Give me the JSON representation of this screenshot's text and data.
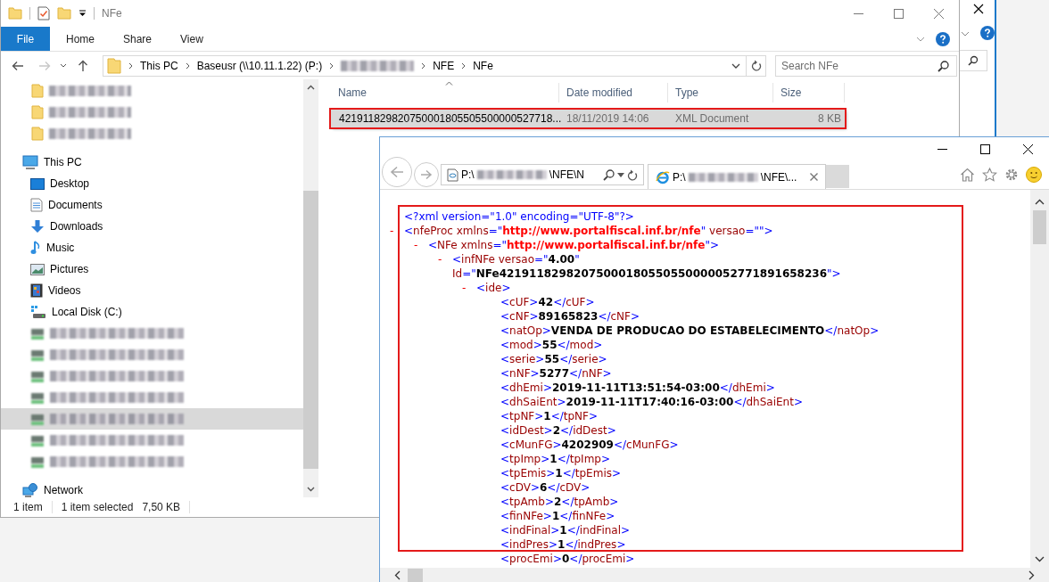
{
  "explorer": {
    "title": "NFe",
    "ribbon_tabs": [
      {
        "label": "File",
        "selected": true
      },
      {
        "label": "Home",
        "selected": false
      },
      {
        "label": "Share",
        "selected": false
      },
      {
        "label": "View",
        "selected": false
      }
    ],
    "breadcrumb": [
      {
        "kind": "text",
        "label": "This PC"
      },
      {
        "kind": "text",
        "label": "Baseusr (\\\\10.11.1.22) (P:)"
      },
      {
        "kind": "blurred"
      },
      {
        "kind": "text",
        "label": "NFE"
      },
      {
        "kind": "text",
        "label": "NFe"
      }
    ],
    "search": {
      "placeholder": "Search NFe"
    },
    "nav": [
      {
        "kind": "folder",
        "selected": false
      },
      {
        "kind": "folder",
        "selected": false
      },
      {
        "kind": "folder",
        "selected": false
      },
      {
        "kind": "pc",
        "label": "This PC",
        "selected": false,
        "children": [
          {
            "kind": "desktop",
            "label": "Desktop",
            "selected": false
          },
          {
            "kind": "documents",
            "label": "Documents",
            "selected": false
          },
          {
            "kind": "downloads",
            "label": "Downloads",
            "selected": false
          },
          {
            "kind": "music",
            "label": "Music",
            "selected": false
          },
          {
            "kind": "pictures",
            "label": "Pictures",
            "selected": false
          },
          {
            "kind": "videos",
            "label": "Videos",
            "selected": false
          },
          {
            "kind": "disk",
            "label": "Local Disk (C:)",
            "selected": false
          },
          {
            "kind": "drive",
            "selected": false
          },
          {
            "kind": "drive",
            "selected": false
          },
          {
            "kind": "drive",
            "selected": false
          },
          {
            "kind": "drive",
            "selected": false
          },
          {
            "kind": "drive",
            "selected": true
          },
          {
            "kind": "drive",
            "selected": false
          },
          {
            "kind": "drive",
            "selected": false
          }
        ]
      },
      {
        "kind": "network",
        "label": "Network",
        "selected": false
      }
    ],
    "columns": [
      "Name",
      "Date modified",
      "Type",
      "Size"
    ],
    "files": [
      {
        "name": "421911829820750001805505500000527718...",
        "date": "18/11/2019 14:06",
        "type": "XML Document",
        "size": "8 KB",
        "selected": true,
        "highlighted": true
      }
    ],
    "status": {
      "count": "1 item",
      "selection": "1 item selected",
      "size": "7,50 KB"
    }
  },
  "browser": {
    "address": {
      "prefix": "P:\\",
      "suffix": "\\NFE\\N"
    },
    "tab": {
      "prefix": "P:\\",
      "suffix": "\\NFE\\...",
      "selected": true
    },
    "xml": {
      "highlighted": true,
      "declaration": [
        {
          "kind": "p",
          "text": "<?xml version=\"1.0\" encoding=\"UTF-8\"?>"
        }
      ],
      "tree": [
        {
          "toggle": "-",
          "line": [
            {
              "kind": "p",
              "text": "<"
            },
            {
              "kind": "t",
              "text": "nfeProc xmlns"
            },
            {
              "kind": "p",
              "text": "=\""
            },
            {
              "kind": "u",
              "text": "http://www.portalfiscal.inf.br/nfe"
            },
            {
              "kind": "p",
              "text": "\""
            },
            {
              "kind": "t",
              "text": " versao"
            },
            {
              "kind": "p",
              "text": "=\"\">"
            }
          ],
          "children": [
            {
              "toggle": "-",
              "line": [
                {
                  "kind": "p",
                  "text": "<"
                },
                {
                  "kind": "t",
                  "text": "NFe xmlns"
                },
                {
                  "kind": "p",
                  "text": "=\""
                },
                {
                  "kind": "u",
                  "text": "http://www.portalfiscal.inf.br/nfe"
                },
                {
                  "kind": "p",
                  "text": "\">"
                }
              ],
              "children": [
                {
                  "toggle": "-",
                  "line": [
                    {
                      "kind": "p",
                      "text": "<"
                    },
                    {
                      "kind": "t",
                      "text": "infNFe versao"
                    },
                    {
                      "kind": "p",
                      "text": "=\""
                    },
                    {
                      "kind": "v",
                      "text": "4.00"
                    },
                    {
                      "kind": "p",
                      "text": "\""
                    }
                  ],
                  "line2": [
                    {
                      "kind": "t",
                      "text": "Id"
                    },
                    {
                      "kind": "p",
                      "text": "=\""
                    },
                    {
                      "kind": "v",
                      "text": "NFe42191182982075000180550550000052771891658236"
                    },
                    {
                      "kind": "p",
                      "text": "\">"
                    }
                  ],
                  "children": [
                    {
                      "toggle": "-",
                      "line": [
                        {
                          "kind": "p",
                          "text": "<"
                        },
                        {
                          "kind": "t",
                          "text": "ide"
                        },
                        {
                          "kind": "p",
                          "text": ">"
                        }
                      ],
                      "children": [
                        {
                          "line": [
                            {
                              "kind": "p",
                              "text": "<"
                            },
                            {
                              "kind": "t",
                              "text": "cUF"
                            },
                            {
                              "kind": "p",
                              "text": ">"
                            },
                            {
                              "kind": "v",
                              "text": "42"
                            },
                            {
                              "kind": "p",
                              "text": "</"
                            },
                            {
                              "kind": "t",
                              "text": "cUF"
                            },
                            {
                              "kind": "p",
                              "text": ">"
                            }
                          ]
                        },
                        {
                          "line": [
                            {
                              "kind": "p",
                              "text": "<"
                            },
                            {
                              "kind": "t",
                              "text": "cNF"
                            },
                            {
                              "kind": "p",
                              "text": ">"
                            },
                            {
                              "kind": "v",
                              "text": "89165823"
                            },
                            {
                              "kind": "p",
                              "text": "</"
                            },
                            {
                              "kind": "t",
                              "text": "cNF"
                            },
                            {
                              "kind": "p",
                              "text": ">"
                            }
                          ]
                        },
                        {
                          "line": [
                            {
                              "kind": "p",
                              "text": "<"
                            },
                            {
                              "kind": "t",
                              "text": "natOp"
                            },
                            {
                              "kind": "p",
                              "text": ">"
                            },
                            {
                              "kind": "v",
                              "text": "VENDA DE PRODUCAO DO ESTABELECIMENTO"
                            },
                            {
                              "kind": "p",
                              "text": "</"
                            },
                            {
                              "kind": "t",
                              "text": "natOp"
                            },
                            {
                              "kind": "p",
                              "text": ">"
                            }
                          ]
                        },
                        {
                          "line": [
                            {
                              "kind": "p",
                              "text": "<"
                            },
                            {
                              "kind": "t",
                              "text": "mod"
                            },
                            {
                              "kind": "p",
                              "text": ">"
                            },
                            {
                              "kind": "v",
                              "text": "55"
                            },
                            {
                              "kind": "p",
                              "text": "</"
                            },
                            {
                              "kind": "t",
                              "text": "mod"
                            },
                            {
                              "kind": "p",
                              "text": ">"
                            }
                          ]
                        },
                        {
                          "line": [
                            {
                              "kind": "p",
                              "text": "<"
                            },
                            {
                              "kind": "t",
                              "text": "serie"
                            },
                            {
                              "kind": "p",
                              "text": ">"
                            },
                            {
                              "kind": "v",
                              "text": "55"
                            },
                            {
                              "kind": "p",
                              "text": "</"
                            },
                            {
                              "kind": "t",
                              "text": "serie"
                            },
                            {
                              "kind": "p",
                              "text": ">"
                            }
                          ]
                        },
                        {
                          "line": [
                            {
                              "kind": "p",
                              "text": "<"
                            },
                            {
                              "kind": "t",
                              "text": "nNF"
                            },
                            {
                              "kind": "p",
                              "text": ">"
                            },
                            {
                              "kind": "v",
                              "text": "5277"
                            },
                            {
                              "kind": "p",
                              "text": "</"
                            },
                            {
                              "kind": "t",
                              "text": "nNF"
                            },
                            {
                              "kind": "p",
                              "text": ">"
                            }
                          ]
                        },
                        {
                          "line": [
                            {
                              "kind": "p",
                              "text": "<"
                            },
                            {
                              "kind": "t",
                              "text": "dhEmi"
                            },
                            {
                              "kind": "p",
                              "text": ">"
                            },
                            {
                              "kind": "v",
                              "text": "2019-11-11T13:51:54-03:00"
                            },
                            {
                              "kind": "p",
                              "text": "</"
                            },
                            {
                              "kind": "t",
                              "text": "dhEmi"
                            },
                            {
                              "kind": "p",
                              "text": ">"
                            }
                          ]
                        },
                        {
                          "line": [
                            {
                              "kind": "p",
                              "text": "<"
                            },
                            {
                              "kind": "t",
                              "text": "dhSaiEnt"
                            },
                            {
                              "kind": "p",
                              "text": ">"
                            },
                            {
                              "kind": "v",
                              "text": "2019-11-11T17:40:16-03:00"
                            },
                            {
                              "kind": "p",
                              "text": "</"
                            },
                            {
                              "kind": "t",
                              "text": "dhSaiEnt"
                            },
                            {
                              "kind": "p",
                              "text": ">"
                            }
                          ]
                        },
                        {
                          "line": [
                            {
                              "kind": "p",
                              "text": "<"
                            },
                            {
                              "kind": "t",
                              "text": "tpNF"
                            },
                            {
                              "kind": "p",
                              "text": ">"
                            },
                            {
                              "kind": "v",
                              "text": "1"
                            },
                            {
                              "kind": "p",
                              "text": "</"
                            },
                            {
                              "kind": "t",
                              "text": "tpNF"
                            },
                            {
                              "kind": "p",
                              "text": ">"
                            }
                          ]
                        },
                        {
                          "line": [
                            {
                              "kind": "p",
                              "text": "<"
                            },
                            {
                              "kind": "t",
                              "text": "idDest"
                            },
                            {
                              "kind": "p",
                              "text": ">"
                            },
                            {
                              "kind": "v",
                              "text": "2"
                            },
                            {
                              "kind": "p",
                              "text": "</"
                            },
                            {
                              "kind": "t",
                              "text": "idDest"
                            },
                            {
                              "kind": "p",
                              "text": ">"
                            }
                          ]
                        },
                        {
                          "line": [
                            {
                              "kind": "p",
                              "text": "<"
                            },
                            {
                              "kind": "t",
                              "text": "cMunFG"
                            },
                            {
                              "kind": "p",
                              "text": ">"
                            },
                            {
                              "kind": "v",
                              "text": "4202909"
                            },
                            {
                              "kind": "p",
                              "text": "</"
                            },
                            {
                              "kind": "t",
                              "text": "cMunFG"
                            },
                            {
                              "kind": "p",
                              "text": ">"
                            }
                          ]
                        },
                        {
                          "line": [
                            {
                              "kind": "p",
                              "text": "<"
                            },
                            {
                              "kind": "t",
                              "text": "tpImp"
                            },
                            {
                              "kind": "p",
                              "text": ">"
                            },
                            {
                              "kind": "v",
                              "text": "1"
                            },
                            {
                              "kind": "p",
                              "text": "</"
                            },
                            {
                              "kind": "t",
                              "text": "tpImp"
                            },
                            {
                              "kind": "p",
                              "text": ">"
                            }
                          ]
                        },
                        {
                          "line": [
                            {
                              "kind": "p",
                              "text": "<"
                            },
                            {
                              "kind": "t",
                              "text": "tpEmis"
                            },
                            {
                              "kind": "p",
                              "text": ">"
                            },
                            {
                              "kind": "v",
                              "text": "1"
                            },
                            {
                              "kind": "p",
                              "text": "</"
                            },
                            {
                              "kind": "t",
                              "text": "tpEmis"
                            },
                            {
                              "kind": "p",
                              "text": ">"
                            }
                          ]
                        },
                        {
                          "line": [
                            {
                              "kind": "p",
                              "text": "<"
                            },
                            {
                              "kind": "t",
                              "text": "cDV"
                            },
                            {
                              "kind": "p",
                              "text": ">"
                            },
                            {
                              "kind": "v",
                              "text": "6"
                            },
                            {
                              "kind": "p",
                              "text": "</"
                            },
                            {
                              "kind": "t",
                              "text": "cDV"
                            },
                            {
                              "kind": "p",
                              "text": ">"
                            }
                          ]
                        },
                        {
                          "line": [
                            {
                              "kind": "p",
                              "text": "<"
                            },
                            {
                              "kind": "t",
                              "text": "tpAmb"
                            },
                            {
                              "kind": "p",
                              "text": ">"
                            },
                            {
                              "kind": "v",
                              "text": "2"
                            },
                            {
                              "kind": "p",
                              "text": "</"
                            },
                            {
                              "kind": "t",
                              "text": "tpAmb"
                            },
                            {
                              "kind": "p",
                              "text": ">"
                            }
                          ]
                        },
                        {
                          "line": [
                            {
                              "kind": "p",
                              "text": "<"
                            },
                            {
                              "kind": "t",
                              "text": "finNFe"
                            },
                            {
                              "kind": "p",
                              "text": ">"
                            },
                            {
                              "kind": "v",
                              "text": "1"
                            },
                            {
                              "kind": "p",
                              "text": "</"
                            },
                            {
                              "kind": "t",
                              "text": "finNFe"
                            },
                            {
                              "kind": "p",
                              "text": ">"
                            }
                          ]
                        },
                        {
                          "line": [
                            {
                              "kind": "p",
                              "text": "<"
                            },
                            {
                              "kind": "t",
                              "text": "indFinal"
                            },
                            {
                              "kind": "p",
                              "text": ">"
                            },
                            {
                              "kind": "v",
                              "text": "1"
                            },
                            {
                              "kind": "p",
                              "text": "</"
                            },
                            {
                              "kind": "t",
                              "text": "indFinal"
                            },
                            {
                              "kind": "p",
                              "text": ">"
                            }
                          ]
                        },
                        {
                          "line": [
                            {
                              "kind": "p",
                              "text": "<"
                            },
                            {
                              "kind": "t",
                              "text": "indPres"
                            },
                            {
                              "kind": "p",
                              "text": ">"
                            },
                            {
                              "kind": "v",
                              "text": "1"
                            },
                            {
                              "kind": "p",
                              "text": "</"
                            },
                            {
                              "kind": "t",
                              "text": "indPres"
                            },
                            {
                              "kind": "p",
                              "text": ">"
                            }
                          ]
                        },
                        {
                          "line": [
                            {
                              "kind": "p",
                              "text": "<"
                            },
                            {
                              "kind": "t",
                              "text": "procEmi"
                            },
                            {
                              "kind": "p",
                              "text": ">"
                            },
                            {
                              "kind": "v",
                              "text": "0"
                            },
                            {
                              "kind": "p",
                              "text": "</"
                            },
                            {
                              "kind": "t",
                              "text": "procEmi"
                            },
                            {
                              "kind": "p",
                              "text": ">"
                            }
                          ]
                        }
                      ]
                    }
                  ]
                }
              ]
            }
          ]
        }
      ]
    }
  }
}
